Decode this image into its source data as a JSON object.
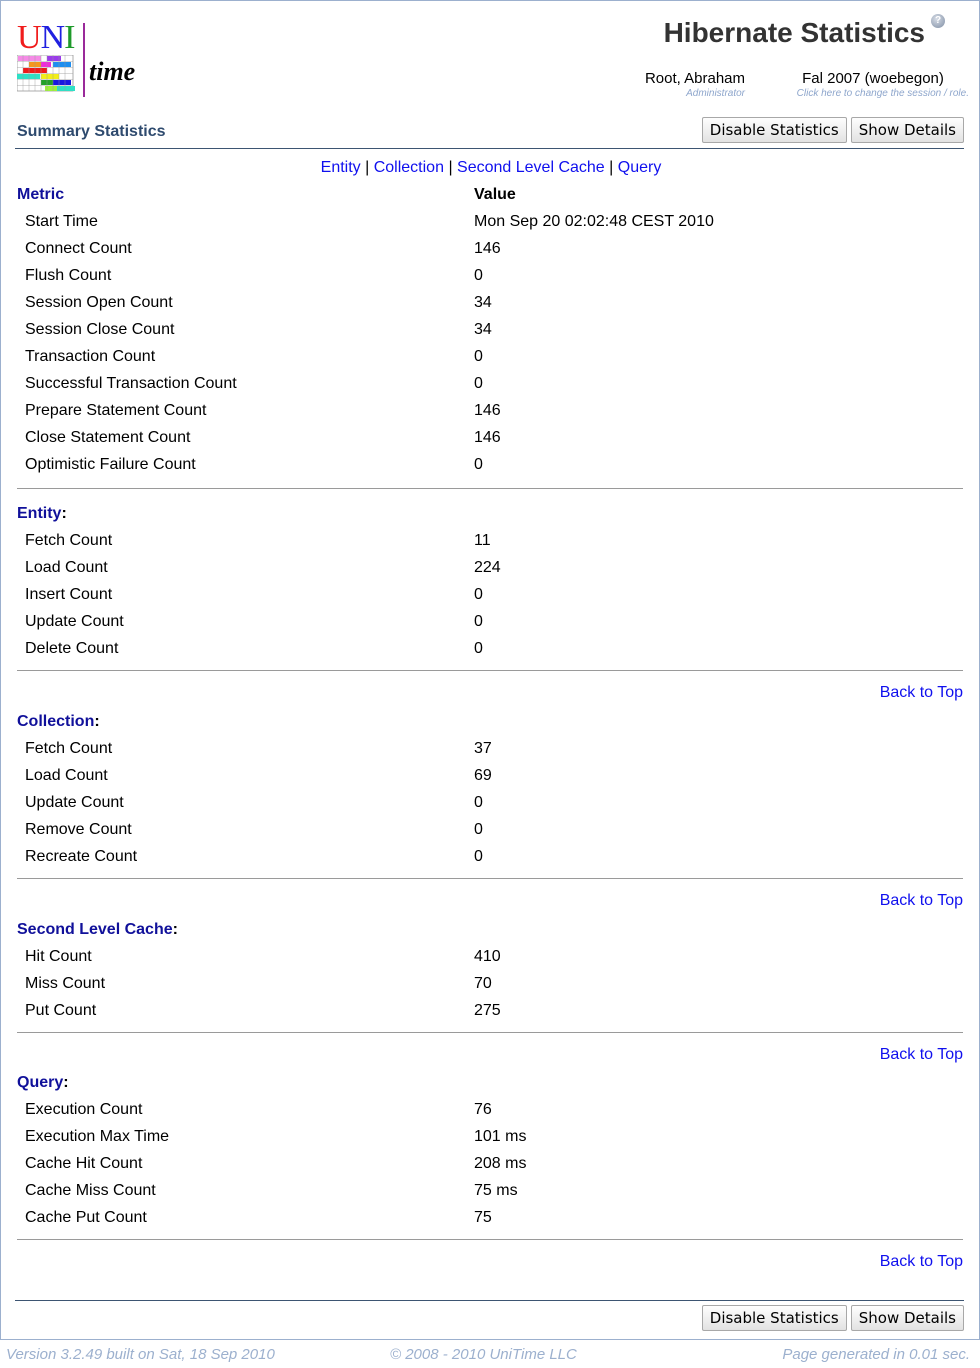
{
  "header": {
    "logo_text": {
      "u": "U",
      "n": "N",
      "i": "I",
      "time": "time"
    },
    "title": "Hibernate Statistics",
    "help_icon": "?",
    "user": {
      "name": "Root, Abraham",
      "role": "Administrator"
    },
    "session": {
      "name": "Fal 2007 (woebegon)",
      "hint": "Click here to change the session / role."
    }
  },
  "toolbar": {
    "section_title": "Summary Statistics",
    "disable_label": "Disable Statistics",
    "details_label": "Show Details"
  },
  "nav": {
    "links": [
      "Entity",
      "Collection",
      "Second Level Cache",
      "Query"
    ],
    "separator": "|"
  },
  "summary": {
    "metric_header": "Metric",
    "value_header": "Value",
    "rows": [
      {
        "label": "Start Time",
        "value": "Mon Sep 20 02:02:48 CEST 2010"
      },
      {
        "label": "Connect Count",
        "value": "146"
      },
      {
        "label": "Flush Count",
        "value": "0"
      },
      {
        "label": "Session Open Count",
        "value": "34"
      },
      {
        "label": "Session Close Count",
        "value": "34"
      },
      {
        "label": "Transaction Count",
        "value": "0"
      },
      {
        "label": "Successful Transaction Count",
        "value": "0"
      },
      {
        "label": "Prepare Statement Count",
        "value": "146"
      },
      {
        "label": "Close Statement Count",
        "value": "146"
      },
      {
        "label": "Optimistic Failure Count",
        "value": "0"
      }
    ]
  },
  "sections": [
    {
      "title": "Entity",
      "rows": [
        {
          "label": "Fetch Count",
          "value": "11"
        },
        {
          "label": "Load Count",
          "value": "224"
        },
        {
          "label": "Insert Count",
          "value": "0"
        },
        {
          "label": "Update Count",
          "value": "0"
        },
        {
          "label": "Delete Count",
          "value": "0"
        }
      ]
    },
    {
      "title": "Collection",
      "rows": [
        {
          "label": "Fetch Count",
          "value": "37"
        },
        {
          "label": "Load Count",
          "value": "69"
        },
        {
          "label": "Update Count",
          "value": "0"
        },
        {
          "label": "Remove Count",
          "value": "0"
        },
        {
          "label": "Recreate Count",
          "value": "0"
        }
      ]
    },
    {
      "title": "Second Level Cache",
      "rows": [
        {
          "label": "Hit Count",
          "value": "410"
        },
        {
          "label": "Miss Count",
          "value": "70"
        },
        {
          "label": "Put Count",
          "value": "275"
        }
      ]
    },
    {
      "title": "Query",
      "rows": [
        {
          "label": "Execution Count",
          "value": "76"
        },
        {
          "label": "Execution Max Time",
          "value": "101 ms"
        },
        {
          "label": "Cache Hit Count",
          "value": "208 ms"
        },
        {
          "label": "Cache Miss Count",
          "value": "75 ms"
        },
        {
          "label": "Cache Put Count",
          "value": "75"
        }
      ]
    }
  ],
  "back_to_top": "Back to Top",
  "colon": ":",
  "footer": {
    "version": "Version 3.2.49 built on Sat, 18 Sep 2010",
    "copyright": "© 2008 - 2010 UniTime LLC",
    "generated": "Page generated in 0.01 sec."
  }
}
